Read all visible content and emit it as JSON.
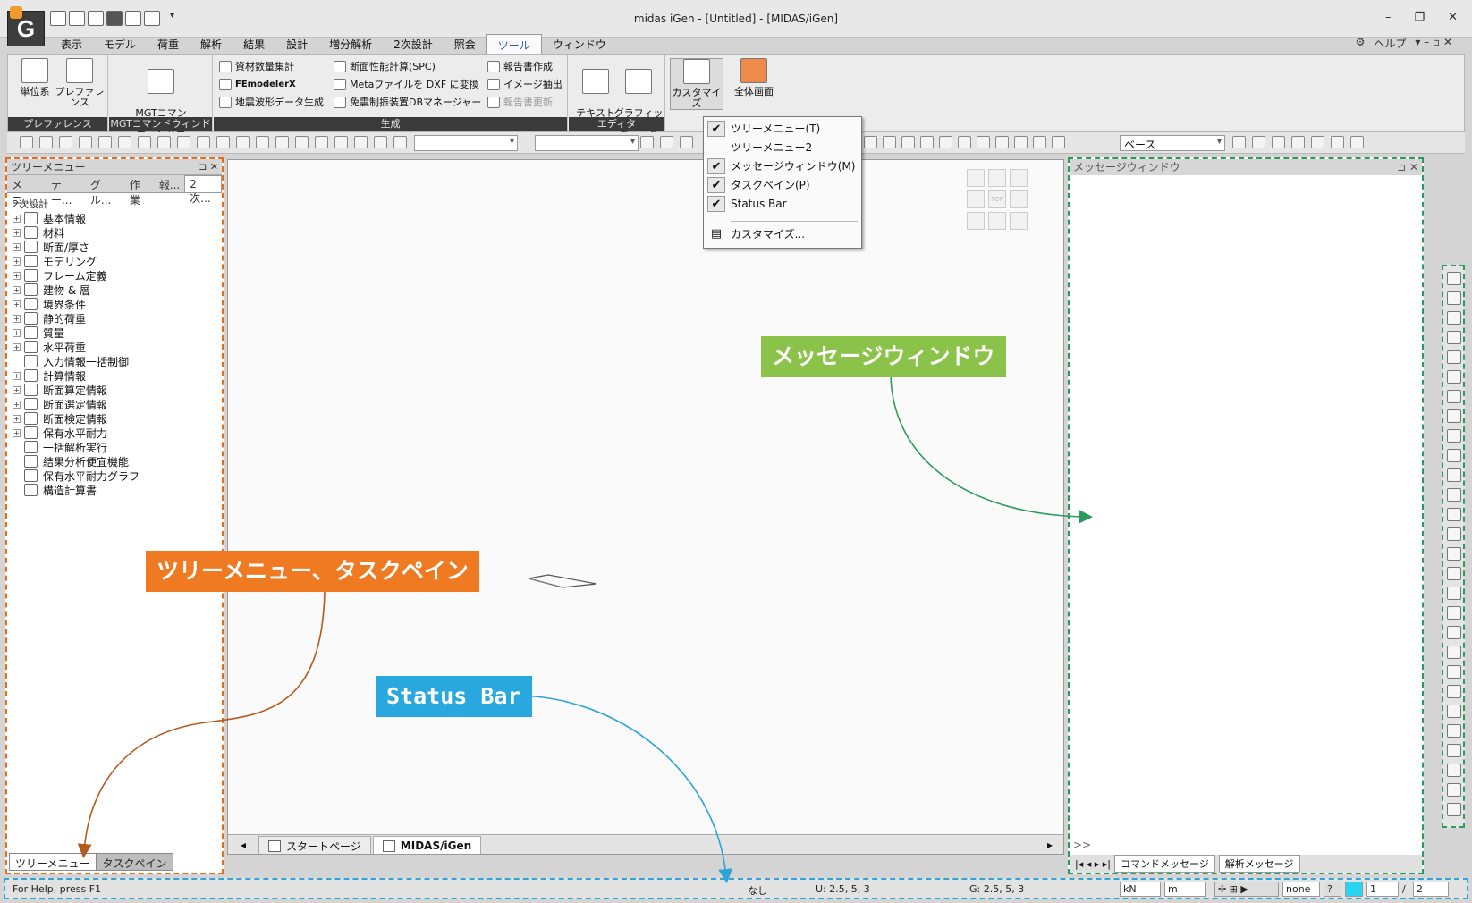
{
  "window": {
    "title": "midas iGen - [Untitled] - [MIDAS/iGen]",
    "minimize": "–",
    "restore": "❐",
    "close": "✕"
  },
  "menu": {
    "tabs": [
      "表示",
      "モデル",
      "荷重",
      "解析",
      "結果",
      "設計",
      "増分解析",
      "2次設計",
      "照会",
      "ツール",
      "ウィンドウ"
    ],
    "active_tab": "ツール",
    "help": "ヘルプ"
  },
  "ribbon": {
    "groups": [
      {
        "label": "プレファレンス",
        "buttons": [
          "単位系",
          "プレファレンス"
        ]
      },
      {
        "label": "MGTコマンドウィンドウ",
        "buttons": [
          "MGTコマンド\nウィンドウ"
        ]
      },
      {
        "label": "生成",
        "items": [
          "資材数量集計",
          "FEmodelerX",
          "地震波形データ生成",
          "断面性能計算(SPC)",
          "Metaファイルを DXF に変換",
          "免震制振装置DBマネージャー",
          "報告書作成",
          "イメージ抽出",
          "報告書更新"
        ]
      },
      {
        "label": "エディタ",
        "buttons": [
          "テキスト\nエディタ",
          "グラフィック\nエディタ"
        ]
      },
      {
        "label": "",
        "buttons": [
          "カスタマイズ",
          "全体画面"
        ]
      }
    ]
  },
  "customize_menu": {
    "items": [
      {
        "label": "ツリーメニュー(T)",
        "checked": true
      },
      {
        "label": "ツリーメニュー2",
        "checked": false
      },
      {
        "label": "メッセージウィンドウ(M)",
        "checked": true
      },
      {
        "label": "タスクペイン(P)",
        "checked": true
      },
      {
        "label": "Status Bar",
        "checked": true
      },
      {
        "label": "カスタマイズ...",
        "checked": false
      }
    ]
  },
  "toolbar": {
    "combo_view": "ベース"
  },
  "tree": {
    "header": "ツリーメニュー",
    "pin": "⊐",
    "close": "✕",
    "tabs": [
      "メニ...",
      "テー...",
      "グル...",
      "作業",
      "報...",
      "2次..."
    ],
    "active_tab": "2次...",
    "root": "2次設計",
    "items": [
      {
        "label": "基本情報",
        "expandable": true
      },
      {
        "label": "材料",
        "expandable": true
      },
      {
        "label": "断面/厚さ",
        "expandable": true
      },
      {
        "label": "モデリング",
        "expandable": true
      },
      {
        "label": "フレーム定義",
        "expandable": true
      },
      {
        "label": "建物 & 層",
        "expandable": true
      },
      {
        "label": "境界条件",
        "expandable": true
      },
      {
        "label": "静的荷重",
        "expandable": true
      },
      {
        "label": "質量",
        "expandable": true
      },
      {
        "label": "水平荷重",
        "expandable": true
      },
      {
        "label": "入力情報一括制御",
        "expandable": false
      },
      {
        "label": "計算情報",
        "expandable": true
      },
      {
        "label": "断面算定情報",
        "expandable": true
      },
      {
        "label": "断面選定情報",
        "expandable": true
      },
      {
        "label": "断面検定情報",
        "expandable": true
      },
      {
        "label": "保有水平耐力",
        "expandable": true
      },
      {
        "label": "一括解析実行",
        "expandable": false
      },
      {
        "label": "結果分析便宜機能",
        "expandable": false
      },
      {
        "label": "保有水平耐力グラフ",
        "expandable": false
      },
      {
        "label": "構造計算書",
        "expandable": false
      }
    ],
    "bottom_tabs": [
      "ツリーメニュー",
      "タスクペイン"
    ]
  },
  "viewport": {
    "cube_label": "TOP",
    "doc_tabs": [
      "スタートページ",
      "MIDAS/iGen"
    ],
    "active_doc": "MIDAS/iGen"
  },
  "message_window": {
    "header": "メッセージウィンドウ",
    "prompt": ">>",
    "tabs": [
      "コマンドメッセージ",
      "解析メッセージ"
    ]
  },
  "statusbar": {
    "help": "For Help, press F1",
    "selection": "なし",
    "ucs": "U: 2.5, 5, 3",
    "gcs": "G: 2.5, 5, 3",
    "unit_force": "kN",
    "unit_length": "m",
    "filter": "none",
    "page": "1",
    "page_total": "2"
  },
  "annotations": {
    "message_window": "メッセージウィンドウ",
    "tree_taskpane": "ツリーメニュー、タスクペイン",
    "status_bar": "Status Bar"
  },
  "colors": {
    "orange": "#f07a22",
    "green": "#8bc34a",
    "blue": "#29a8e0",
    "arrow_orange": "#b55a1c",
    "arrow_green": "#2a9b5a",
    "arrow_blue": "#2ea5d6"
  }
}
